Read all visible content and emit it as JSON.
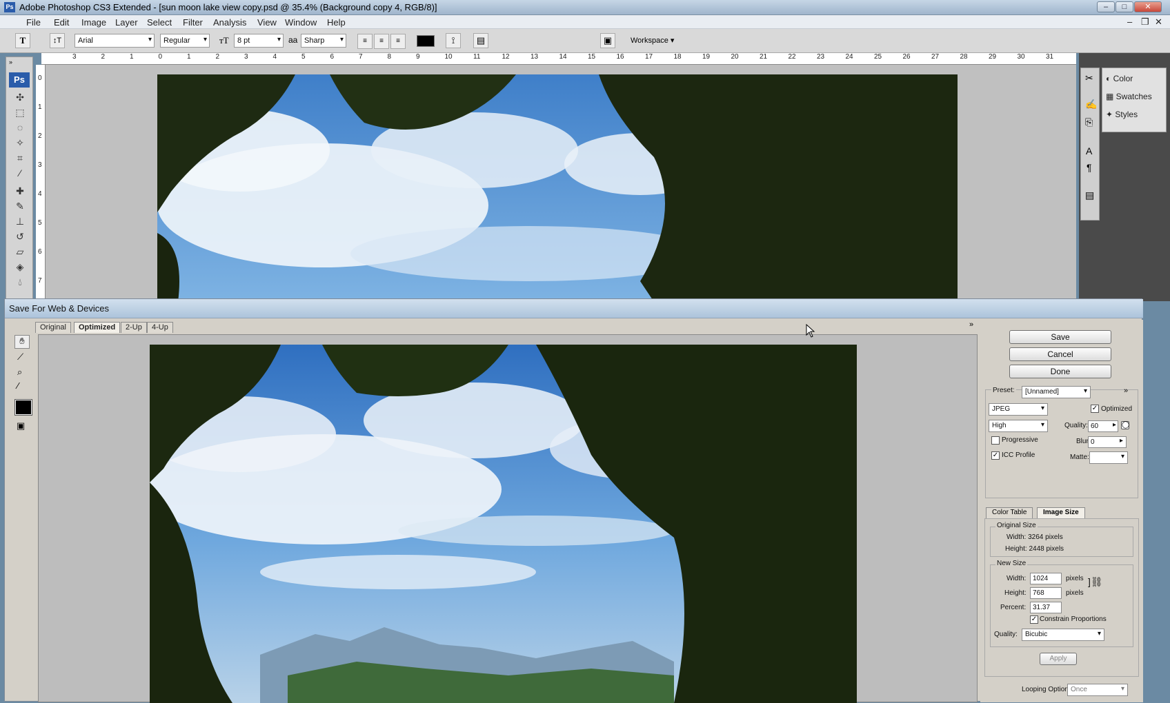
{
  "app": {
    "title": "Adobe Photoshop CS3 Extended - [sun moon lake view copy.psd @ 35.4% (Background copy 4, RGB/8)]",
    "ps_logo": "Ps"
  },
  "menu": [
    "File",
    "Edit",
    "Image",
    "Layer",
    "Select",
    "Filter",
    "Analysis",
    "View",
    "Window",
    "Help"
  ],
  "options": {
    "font_family": "Arial",
    "font_style": "Regular",
    "font_size": "8 pt",
    "aa_icon": "aa",
    "antialias": "Sharp",
    "workspace": "Workspace ▾",
    "text_tool_glyph": "T"
  },
  "ruler_numbers": [
    "3",
    "2",
    "1",
    "0",
    "1",
    "2",
    "3",
    "4",
    "5",
    "6",
    "7",
    "8",
    "9",
    "10",
    "11",
    "12",
    "13",
    "14",
    "15",
    "16",
    "17",
    "18",
    "19",
    "20",
    "21",
    "22",
    "23",
    "24",
    "25",
    "26",
    "27",
    "28",
    "29",
    "30",
    "31"
  ],
  "left_ruler_numbers": [
    "0",
    "1",
    "2",
    "3",
    "4",
    "5",
    "6",
    "7"
  ],
  "dock": {
    "panels": [
      "Color",
      "Swatches",
      "Styles"
    ]
  },
  "dialog": {
    "title": "Save For Web & Devices",
    "tabs": [
      "Original",
      "Optimized",
      "2-Up",
      "4-Up"
    ],
    "buttons": {
      "save": "Save",
      "cancel": "Cancel",
      "done": "Done"
    },
    "preset_label": "Preset:",
    "preset_value": "[Unnamed]",
    "format": "JPEG",
    "quality_preset": "High",
    "optimized_label": "Optimized",
    "quality_label": "Quality:",
    "quality_value": "60",
    "progressive_label": "Progressive",
    "blur_label": "Blur:",
    "blur_value": "0",
    "icc_label": "ICC Profile",
    "matte_label": "Matte:",
    "subtabs": [
      "Color Table",
      "Image Size"
    ],
    "original_size_label": "Original Size",
    "orig_width": "Width: 3264 pixels",
    "orig_height": "Height: 2448 pixels",
    "new_size_label": "New Size",
    "width_label": "Width:",
    "width_value": "1024",
    "height_label": "Height:",
    "height_value": "768",
    "pixels": "pixels",
    "percent_label": "Percent:",
    "percent_value": "31.37",
    "constrain_label": "Constrain Proportions",
    "resample_quality_label": "Quality:",
    "resample_value": "Bicubic",
    "apply": "Apply",
    "looping_label": "Looping Options:",
    "looping_value": "Once",
    "expand_glyph": "»"
  },
  "colors": {
    "accent": "#2a5caa",
    "sky": "#5f95d3",
    "foliage": "#1f2a12"
  }
}
